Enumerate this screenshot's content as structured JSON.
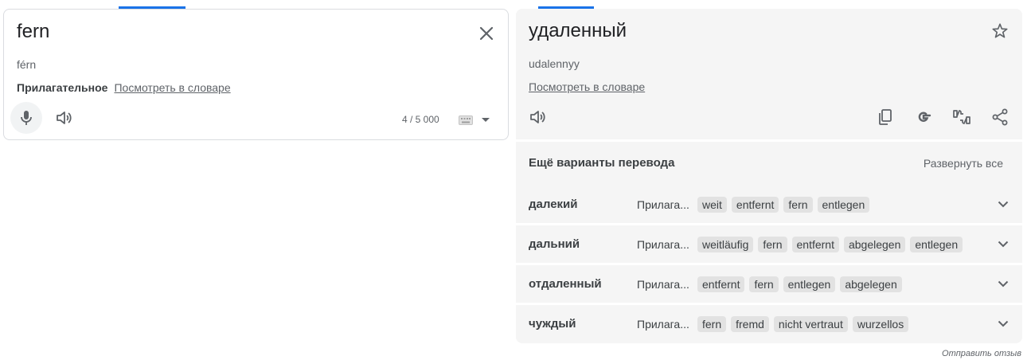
{
  "source": {
    "text": "fern",
    "transliteration": "férn",
    "part_of_speech": "Прилагательное",
    "dictionary_link": "Посмотреть в словаре",
    "char_count": "4 / 5 000",
    "icons": [
      "close-icon",
      "microphone-icon",
      "speaker-icon",
      "keyboard-icon",
      "dropdown-icon"
    ]
  },
  "target": {
    "text": "удаленный",
    "transliteration": "udalennyy",
    "dictionary_link": "Посмотреть в словаре",
    "icons": [
      "star-icon",
      "speaker-icon",
      "copy-icon",
      "google-icon",
      "rate-icon",
      "share-icon"
    ]
  },
  "more_translations": {
    "title": "Ещё варианты перевода",
    "expand_all": "Развернуть все",
    "rows": [
      {
        "word": "далекий",
        "pos": "Прилага...",
        "chips": [
          "weit",
          "entfernt",
          "fern",
          "entlegen"
        ]
      },
      {
        "word": "дальний",
        "pos": "Прилага...",
        "chips": [
          "weitläufig",
          "fern",
          "entfernt",
          "abgelegen",
          "entlegen"
        ]
      },
      {
        "word": "отдаленный",
        "pos": "Прилага...",
        "chips": [
          "entfernt",
          "fern",
          "entlegen",
          "abgelegen"
        ]
      },
      {
        "word": "чуждый",
        "pos": "Прилага...",
        "chips": [
          "fern",
          "fremd",
          "nicht vertraut",
          "wurzellos"
        ]
      }
    ]
  },
  "feedback": "Отправить отзыв",
  "colors": {
    "accent": "#1a73e8",
    "panel_bg": "#f5f5f5",
    "chip_bg": "#e2e2e2"
  }
}
